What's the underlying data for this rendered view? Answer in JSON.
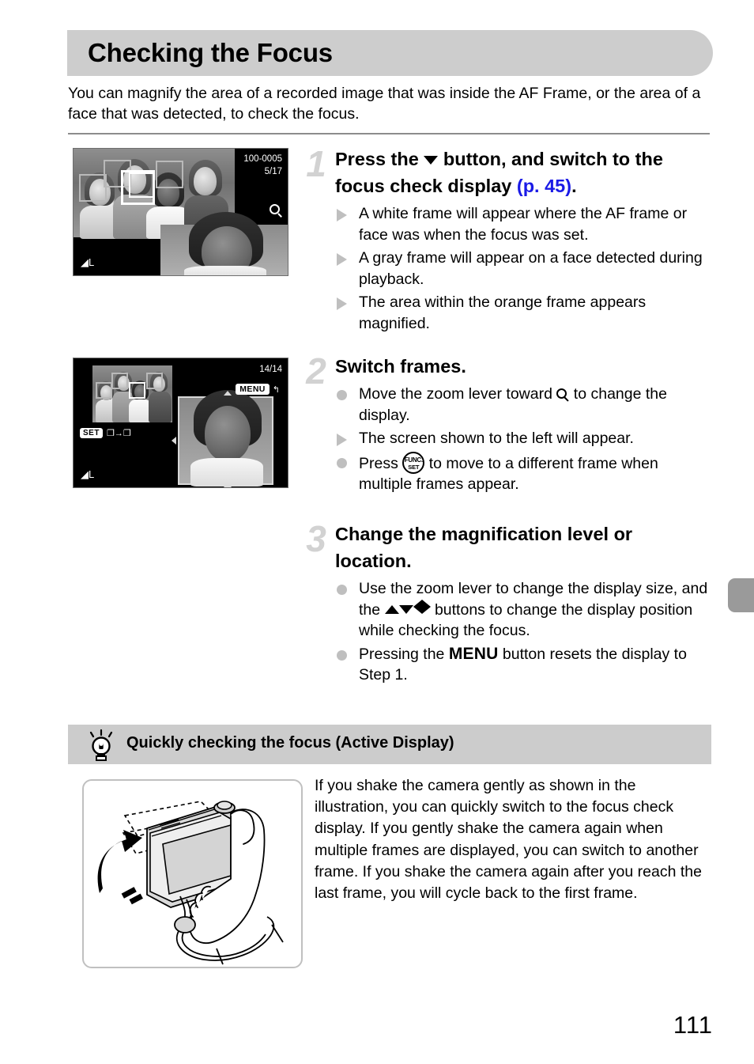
{
  "header": {
    "title": "Checking the Focus"
  },
  "intro": "You can magnify the area of a recorded image that was inside the AF Frame, or the area of a face that was detected, to check the focus.",
  "figures": {
    "screen_1": {
      "file_number": "100-0005",
      "frame_counter": "5/17",
      "quality_mark": "L",
      "zoom_hint_icon": "magnifier-icon"
    },
    "screen_2": {
      "frame_counter": "14/14",
      "menu_badge_label": "MENU",
      "menu_badge_icon": "return-arrow-icon",
      "set_badge_label": "SET",
      "set_badge_hint": "frame-to-frame-icon",
      "quality_mark": "L"
    }
  },
  "steps": [
    {
      "number": "1",
      "title_before": "Press the",
      "title_icon": "down-button-icon",
      "title_middle": "button, and switch to the focus check display",
      "title_pageref": "(p. 45)",
      "title_after": ".",
      "bullets": [
        {
          "marker": "triangle",
          "text": "A white frame will appear where the AF frame or face was when the focus was set."
        },
        {
          "marker": "triangle",
          "text": "A gray frame will appear on a face detected during playback."
        },
        {
          "marker": "triangle",
          "text": "The area within the orange frame appears magnified."
        }
      ]
    },
    {
      "number": "2",
      "title": "Switch frames.",
      "bullets": [
        {
          "marker": "dot",
          "text_before": "Move the zoom lever toward",
          "icon": "magnifier-icon",
          "text_after": "to change the display."
        },
        {
          "marker": "triangle",
          "text": "The screen shown to the left will appear."
        },
        {
          "marker": "dot",
          "text_before": "Press",
          "icon": "func-set-icon",
          "icon_line1": "FUNC.",
          "icon_line2": "SET",
          "text_after": "to move to a different frame when multiple frames appear."
        }
      ]
    },
    {
      "number": "3",
      "title": "Change the magnification level or location.",
      "bullets": [
        {
          "marker": "dot",
          "text_before": "Use the zoom lever to change the display size, and the",
          "icon": "direction-buttons-icon",
          "text_after": "buttons to change the display position while checking the focus."
        },
        {
          "marker": "dot",
          "text_before": "Pressing the",
          "icon_label": "MENU",
          "text_after": "button resets the display to Step 1."
        }
      ]
    }
  ],
  "tip": {
    "icon": "lightbulb-icon",
    "title": "Quickly checking the focus (Active Display)",
    "figure_name": "shake-camera-illustration",
    "body": "If you shake the camera gently as shown in the illustration, you can quickly switch to the focus check display. If you gently shake the camera again when multiple frames are displayed, you can switch to another frame. If you shake the camera again after you reach the last frame, you will cycle back to the first frame."
  },
  "page_number": "111",
  "colors": {
    "header_bar": "#cdcdcd",
    "tip_bar": "#cccccc",
    "page_ref_link": "#1a1ae6",
    "step_number": "#d2d2d2",
    "marker_gray": "#bfbfbf",
    "chapter_tab": "#9a9a9a"
  }
}
